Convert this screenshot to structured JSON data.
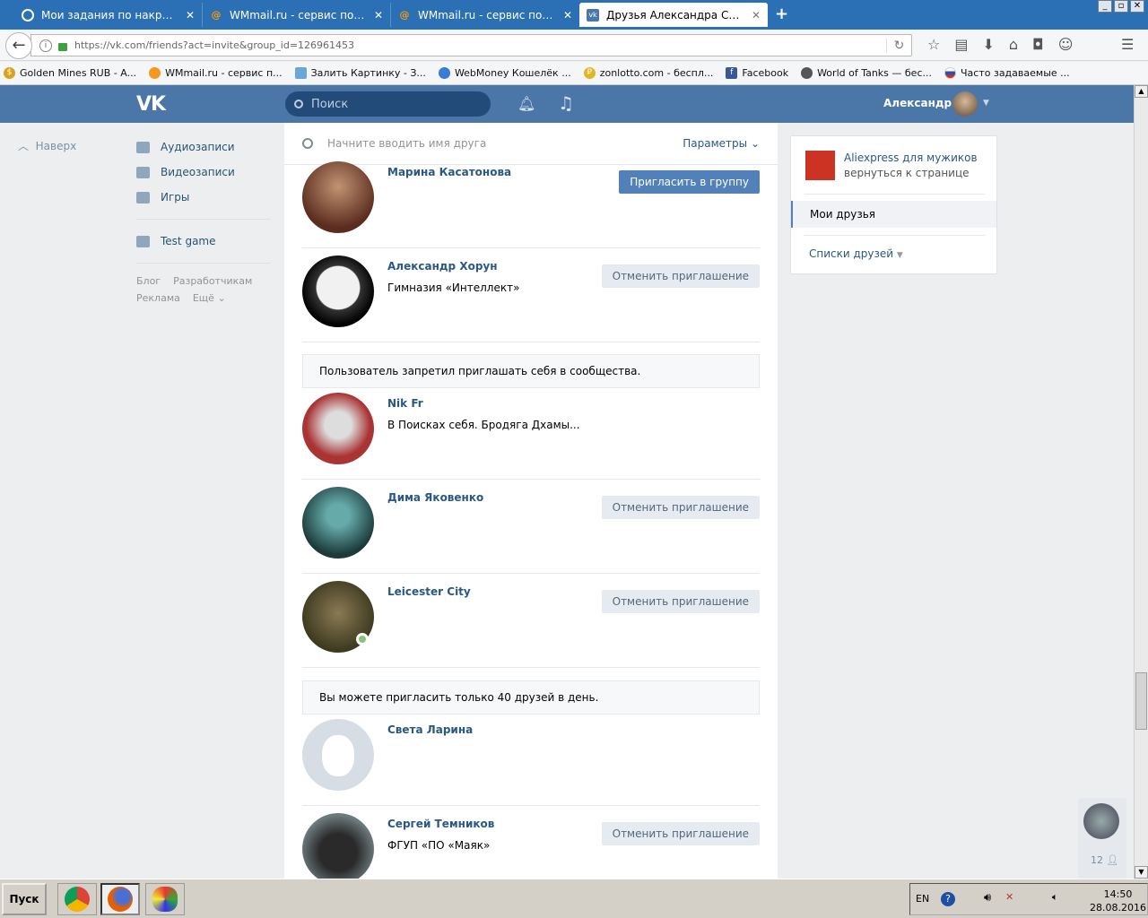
{
  "browser": {
    "tabs": [
      {
        "title": "Мои задания по накрутке",
        "active": false
      },
      {
        "title": "WMmail.ru - сервис почтовы...",
        "active": false
      },
      {
        "title": "WMmail.ru - сервис почтовы...",
        "active": false
      },
      {
        "title": "Друзья Александра Свибол...",
        "active": true
      }
    ],
    "url_host": "https://vk.com",
    "url_path": "/friends?act=invite&group_id=126961453",
    "bookmarks": [
      "Golden Mines RUB - A...",
      "WMmail.ru - сервис п...",
      "Залить Картинку - З...",
      "WebMoney Кошелёк ...",
      "zonlotto.com - беспл...",
      "Facebook",
      "World of Tanks — бес...",
      "Часто задаваемые ..."
    ]
  },
  "vk": {
    "search_placeholder": "Поиск",
    "user_name": "Александр",
    "up_label": "Наверх",
    "left_menu": [
      "Аудиозаписи",
      "Видеозаписи",
      "Игры"
    ],
    "left_app": "Test game",
    "footer_links": [
      "Блог",
      "Разработчикам",
      "Реклама",
      "Ещё"
    ],
    "friend_search_placeholder": "Начните вводить имя друга",
    "params_label": "Параметры",
    "friends": [
      {
        "name": "Марина Касатонова",
        "sub": "",
        "button": "Пригласить в группу",
        "button_type": "primary",
        "online": false
      },
      {
        "name": "Александр Хорун",
        "sub": "Гимназия «Интеллект»",
        "button": "Отменить приглашение",
        "button_type": "secondary",
        "online": false
      },
      {
        "notice": "Пользователь запретил приглашать себя в сообщества."
      },
      {
        "name": "Nik Fr",
        "sub": "В Поисках себя. Бродяга Дхамы...",
        "button": "",
        "button_type": "",
        "online": false
      },
      {
        "name": "Дима Яковенко",
        "sub": "",
        "button": "Отменить приглашение",
        "button_type": "secondary",
        "online": false
      },
      {
        "name": "Leicester City",
        "sub": "",
        "button": "Отменить приглашение",
        "button_type": "secondary",
        "online": true
      },
      {
        "notice": "Вы можете пригласить только 40 друзей в день."
      },
      {
        "name": "Света Ларина",
        "sub": "",
        "button": "",
        "button_type": "",
        "online": false
      },
      {
        "name": "Сергей Темников",
        "sub": "ФГУП «ПО «Маяк»",
        "button": "Отменить приглашение",
        "button_type": "secondary",
        "online": false
      }
    ],
    "right": {
      "group_title": "Aliexpress для мужиков",
      "group_back": "вернуться к странице",
      "selected": "Мои друзья",
      "lists": "Списки друзей"
    },
    "chat_count": "12"
  },
  "taskbar": {
    "start": "Пуск",
    "lang": "EN",
    "time": "14:50",
    "date": "28.08.2016"
  }
}
